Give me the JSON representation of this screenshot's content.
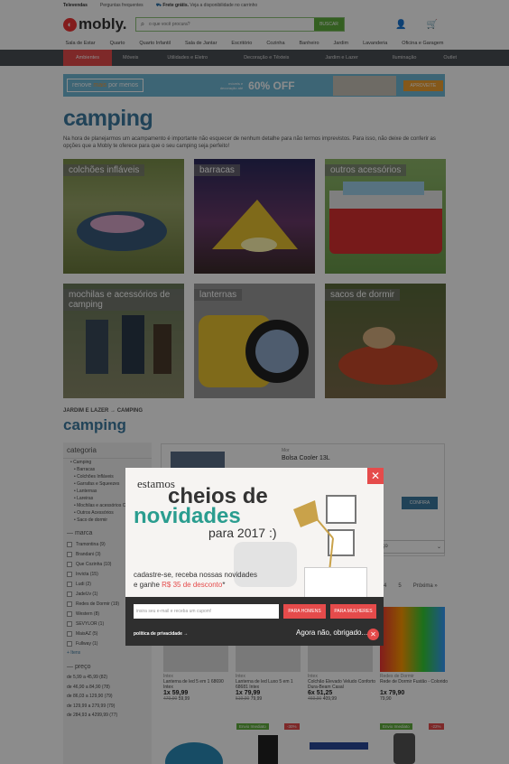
{
  "topbar": {
    "televendas": "Televendas",
    "perguntas": "Perguntas frequentes",
    "frete": "Frete grátis.",
    "frete_note": "Veja a disponibilidade no carrinho"
  },
  "header": {
    "logo": "mobly.",
    "search_placeholder": "o que você procura?",
    "search_button": "BUSCAR"
  },
  "catnav": [
    "Sala de Estar",
    "Quarto",
    "Quarto Infantil",
    "Sala de Jantar",
    "Escritório",
    "Cozinha",
    "Banheiro",
    "Jardim",
    "Lavanderia",
    "Oficina e Garagem"
  ],
  "subnav": [
    "Ambientes",
    "Móveis",
    "Utilidades e Eletro",
    "Decoração e Têxteis",
    "Jardim e Lazer",
    "Iluminação",
    "Outlet"
  ],
  "banner": {
    "renove": "renove",
    "mais": "mais",
    "por_menos": "por menos",
    "small": "móveis e decoração até",
    "offer": "60% OFF",
    "cta": "APROVEITE"
  },
  "page": {
    "title": "camping",
    "intro": "Na hora de planejarmos um acampamento é importante não esquecer de nenhum detalhe para não termos imprevistos. Para isso, não deixe de conferir as opções que a Mobly te oferece para que o seu camping seja perfeito!"
  },
  "tiles": [
    {
      "label": "colchões infláveis"
    },
    {
      "label": "barracas"
    },
    {
      "label": "outros acessórios"
    },
    {
      "label": "mochilas e acessórios de camping"
    },
    {
      "label": "lanternas"
    },
    {
      "label": "sacos de dormir"
    }
  ],
  "breadcrumb": {
    "a": "JARDIM E LAZER",
    "b": "CAMPING"
  },
  "subtitle": "camping",
  "sidebar": {
    "categoria": "categoria",
    "categories": [
      "Camping",
      "Barracas",
      "Colchões Infláveis",
      "Garrafas e Squeezes",
      "Lanternas",
      "Lareiras",
      "Mochilas e acessórios Camping",
      "Outros Acessórios",
      "Saco de dormir"
    ],
    "marca": "marca",
    "brands": [
      "Tramontina (9)",
      "Brandani (3)",
      "Que Cozinha (10)",
      "Invicta (15)",
      "Ludi (2)",
      "JadeUv (1)",
      "Redes de Dormir (19)",
      "Western (8)",
      "SEVYLOR (1)",
      "MaisAZ (5)",
      "Fullway (1)"
    ],
    "more": "+ Itens",
    "preco": "preço",
    "prices": [
      "de 5,99 a 45,99 (82)",
      "de 46,90 a 84,90 (78)",
      "de 86,03 a 129,90 (79)",
      "de 129,99 a 279,99 (79)",
      "de 284,93 a 4299,99 (77)"
    ]
  },
  "featured": {
    "brand": "Mor",
    "name": "Bolsa Cooler 13L",
    "button": "CONFIRA"
  },
  "sort": {
    "label": "reço"
  },
  "pagination": {
    "p4": "4",
    "p5": "5",
    "next": "Próxima »"
  },
  "products": [
    {
      "brand": "Intex",
      "name": "Lanterna de led 5 em 1 68690 Intex",
      "inst": "1x 59,99",
      "old": "479,90",
      "price": "59,99"
    },
    {
      "brand": "Intex",
      "name": "Lanterna de led Luxo 5 em 1 68681 Intex",
      "inst": "1x 79,99",
      "old": "519,90",
      "price": "79,99"
    },
    {
      "brand": "Intex",
      "name": "Colchão Elevado Veludo Conforto Dura-Beam Casal",
      "inst": "6x 51,25",
      "old": "469,90",
      "price": "409,99"
    },
    {
      "brand": "Redes de Dormir",
      "name": "Rede de Dormir Fustão - Colorido",
      "inst": "1x 79,90",
      "old": "",
      "price": "79,90"
    }
  ],
  "tags": {
    "envio": "Envio Imediato",
    "d1": "-30%",
    "d2": "-22%"
  },
  "modal": {
    "estamos": "estamos",
    "cheios": "cheios de",
    "novidades": "novidades",
    "para": "para 2017 :)",
    "cadastre": "cadastre-se, receba nossas novidades",
    "ganhe": "e ganhe",
    "desconto": "R$ 35 de desconto",
    "email_placeholder": "insira seu e-mail e receba um cupom!",
    "homens": "PARA HOMENS",
    "mulheres": "PARA MULHERES",
    "politica": "política de privacidade",
    "later": "Agora não, obrigado...",
    "accent": "#e54b4b"
  }
}
